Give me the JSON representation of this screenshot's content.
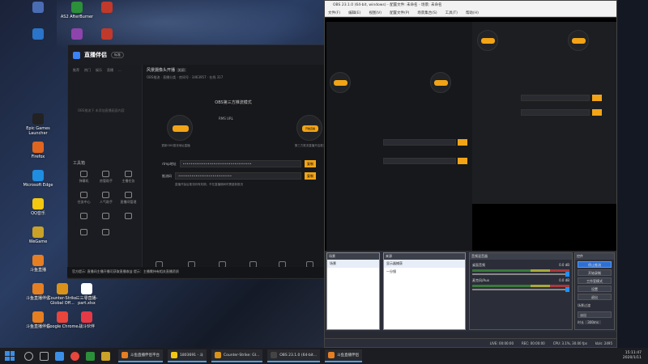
{
  "desktop": {
    "icons": [
      {
        "label": "",
        "color": "#4a6cb3"
      },
      {
        "label": "AS2 AfterBurner",
        "color": "#2c8f3a"
      },
      {
        "label": "",
        "color": "#c0392b"
      },
      {
        "label": "",
        "color": "#2a74c9"
      },
      {
        "label": "",
        "color": "#8e44ad"
      },
      {
        "label": "",
        "color": "#c0392b"
      },
      {
        "label": "Epic Games Launcher",
        "color": "#222222"
      },
      {
        "label": "Firefox",
        "color": "#e0651f"
      },
      {
        "label": "Microsoft Edge",
        "color": "#1f8de0"
      },
      {
        "label": "QQ音乐",
        "color": "#f2c811"
      },
      {
        "label": "WeGame",
        "color": "#c9a227"
      },
      {
        "label": "斗鱼直播",
        "color": "#e67e22"
      },
      {
        "label": "斗鱼直播伴侣",
        "color": "#e67e22"
      },
      {
        "label": "Counter-Strike Global Off...",
        "color": "#d9931a"
      },
      {
        "label": "三三零直播-part.xlsx",
        "color": "#ffffff"
      },
      {
        "label": "斗鱼直播伴侣",
        "color": "#e67e22"
      },
      {
        "label": "Google Chrome",
        "color": "#e8453c"
      },
      {
        "label": "战斗伙伴",
        "color": "#e63946"
      }
    ]
  },
  "stream_app": {
    "brand": "直播伴侣",
    "version_badge": "标准",
    "tabs": [
      "推荐",
      "热门",
      "娱乐",
      "直播",
      "..."
    ],
    "empty_hint": "OBS推流下 未添加直播画面内容",
    "tools_header": "工具箱",
    "tools": [
      "弹幕机",
      "房管助手",
      "主播任务",
      "任务中心",
      "人气助手",
      "直播间管理",
      "",
      "",
      "",
      "",
      ""
    ],
    "room_title": "风景摄像头开播",
    "room_tag": "关闭",
    "room_sub": "OBS推流 · 直播分类 · 房间号 · 3463957 · 在线 317",
    "mode_title": "OBS第三方推流模式",
    "step_labels": [
      "RMS URL",
      "复制-推流码"
    ],
    "step_buttons": [
      "",
      "",
      "开始直播"
    ],
    "step_captions": [
      "更新OBS推流地址直播",
      "",
      "第三方推流直播开启推流"
    ],
    "rtmp_label": "rtmp地址",
    "rtmp_value": "••••••••••••••••••••••••••••••••••••",
    "key_label": "推流码",
    "key_value": "••••••••••••••••••••••••••••",
    "copy_label": "复制",
    "note": "直播开始后推流码有效期，不在直播期间时需重新推流",
    "bottom_tools": [
      "直播间设置",
      "弹幕助手",
      "互动工具",
      "房间管理",
      "麦克风",
      "扬声器"
    ],
    "notice": "官方提示: 直播间主播开播可获取直播收益 提示：主播需持有相关直播资质"
  },
  "obs": {
    "title": "OBS 23.1.0 (64-bit, windows) - 配置文件: 未命名 - 场景: 未命名",
    "menu": [
      "文件(F)",
      "编辑(E)",
      "视图(V)",
      "配置文件(P)",
      "场景集合(S)",
      "工具(T)",
      "帮助(H)"
    ],
    "scenes_header": "场景",
    "scene_items": [
      "场景"
    ],
    "sources_header": "来源",
    "source_items": [
      "显示器捕获",
      "一分镜"
    ],
    "mixer_header": "音频混音器",
    "tracks": [
      {
        "name": "桌面音频",
        "db": "0.0 dB"
      },
      {
        "name": "麦克风/Aux",
        "db": "0.0 dB"
      }
    ],
    "controls_header": "控件",
    "control_buttons": [
      "停止推流",
      "开始录制",
      "工作室模式",
      "设置",
      "退出"
    ],
    "transition_header": "场景过渡",
    "transition_value": "淡出",
    "duration_label": "时长",
    "duration_value": "300ms",
    "status_items": [
      "LIVE: 00:00:00",
      "REC: 00:00:00",
      "CPU: 3.1%, 30.00 fps",
      "kb/s: 2495"
    ]
  },
  "taskbar": {
    "apps": [
      {
        "label": "斗鱼直播伴侣平台",
        "color": "#e67e22"
      },
      {
        "label": "1803691 - 斗",
        "color": "#f2c811"
      },
      {
        "label": "Counter-Strike: Gl...",
        "color": "#d9931a"
      },
      {
        "label": "OBS 23.1.0 (64-bit...",
        "color": "#444444"
      },
      {
        "label": "斗鱼直播伴侣",
        "color": "#e67e22"
      }
    ],
    "time": "15:11:47",
    "date": "2020/1/11"
  }
}
